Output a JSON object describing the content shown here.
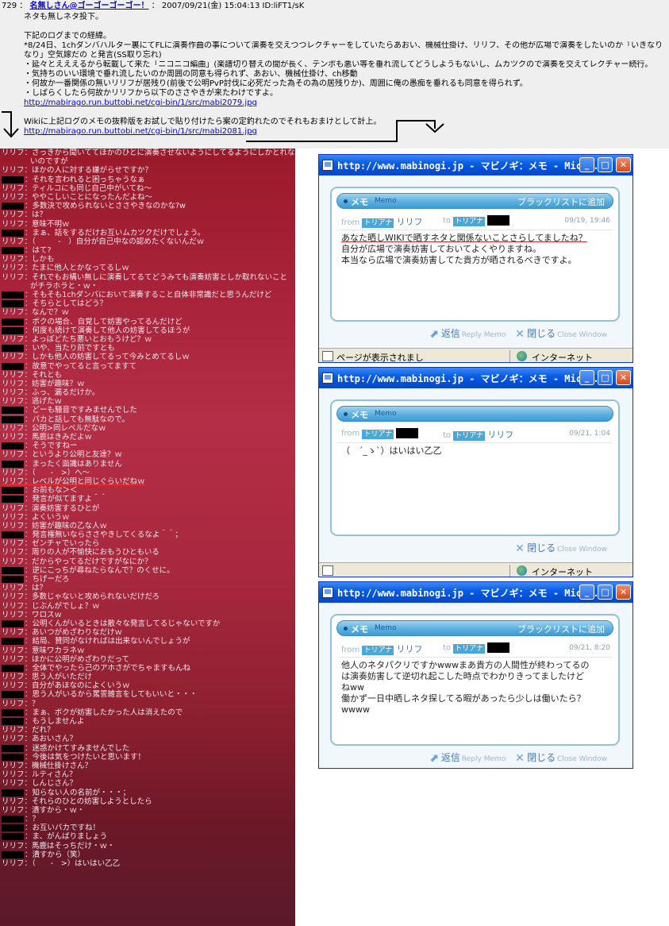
{
  "post": {
    "number": "729",
    "name": "名無しさん@ゴーゴーゴーゴー！",
    "datetime": "2007/09/21(金) 15:04:13 ID:liFT1/sK",
    "lines": [
      "ネタも無しネタ投下。",
      "",
      "下記のログまでの経緯。",
      "*8/24日、1chダンバハルター裏にてFLに演奏作曲の事について演奏を交えつつレクチャーをしていたらあおい、機械仕掛け、リリフ、その他が広場で演奏をしたいのか「いきなり」",
      "なり」空気嫁だの と発言(SS取り忘れ)",
      "・延々とえええるから転載して来た「ニコニコ編曲」(楽譜切り替えの間が長く、テンポも悪い等を垂れ流してどうしようもないし、ムカツクので演奏を交えてレクチャー続行。",
      "・気持ちのいい環境で垂れ流したいのか周囲の同意も得られず、あおい、機械仕掛け、ch移動",
      "・何故か一番関係の無いリリフが居残り(前後で公明PvP討伐に必死だった為その為の居残りか)、周囲に俺の愚痴を垂れるも同意を得られず。",
      "・しばらくしたら何故かリリフから以下のささやきが来たわけですよ。"
    ],
    "link1": "http://mabirago.run.buttobi.net/cgi-bin/1/src/mabi2079.jpg",
    "note": "Wikiに上記ログのメモの抜粋版をお試しで貼り付けたら案の定釣れたのでそれもおまけとして計上。",
    "link2": "http://mabirago.run.buttobi.net/cgi-bin/1/src/mabi2081.jpg"
  },
  "chat": [
    {
      "s": "リリフ",
      "t": "：さっきから聞いててほかのひとに演奏させないようにしてるようにしかとれないのですが"
    },
    {
      "s": "",
      "t": "いのですが",
      "cont": true
    },
    {
      "s": "リリフ",
      "t": "：ほかの人に対する嫌がらせですか？"
    },
    {
      "s": "",
      "t": "：それを言われると困っちゃうなぁ"
    },
    {
      "s": "リリフ",
      "t": "：ティルコにも同じ自己中がいてね～"
    },
    {
      "s": "リリフ",
      "t": "：ややこしいことになったんだよね～"
    },
    {
      "s": "",
      "t": "：多数決で攻められないとささやきなのかな?w"
    },
    {
      "s": "リリフ",
      "t": "：は？"
    },
    {
      "s": "リリフ",
      "t": "：意味不明ｗ"
    },
    {
      "s": "",
      "t": "：まぁ、話をするだけお互いムカツクだけでしょう。"
    },
    {
      "s": "リリフ",
      "t": "：（　　　-　）自分が自己中なの認めたくないんだｗ"
    },
    {
      "s": "",
      "t": "：はて?"
    },
    {
      "s": "リリフ",
      "t": "：しかも"
    },
    {
      "s": "リリフ",
      "t": "：たまに他人とかなってるしｗ"
    },
    {
      "s": "リリフ",
      "t": "：それでもお構い無しに演奏してるてどうみても演奏妨害としか取れないこと"
    },
    {
      "s": "",
      "t": "がチラホラと・ｗ・",
      "cont": true
    },
    {
      "s": "",
      "t": "：そもそも1chダンバにおいて演奏すること自体非常識だと思うんだけど"
    },
    {
      "s": "",
      "t": "：そちらとしてはどう？"
    },
    {
      "s": "リリフ",
      "t": "：なんで？ｗ"
    },
    {
      "s": "",
      "t": "：ボクの場合、自覚して妨害やってるんだけど"
    },
    {
      "s": "",
      "t": "：何度も続けて演奏して他人の妨害してるほうが"
    },
    {
      "s": "リリフ",
      "t": "：よっぽどたち悪いとおもうけど？ｗ"
    },
    {
      "s": "",
      "t": "：いや、当たり前ですとも"
    },
    {
      "s": "リリフ",
      "t": "：しかも他人の妨害してるって今みとめてるしｗ"
    },
    {
      "s": "",
      "t": "：故意でやってると言ってますて"
    },
    {
      "s": "リリフ",
      "t": "：それとも"
    },
    {
      "s": "リリフ",
      "t": "：妨害が趣味？ｗ"
    },
    {
      "s": "リリフ",
      "t": "：ふっ、漏るだけか。"
    },
    {
      "s": "リリフ",
      "t": "：逃げたｗ"
    },
    {
      "s": "",
      "t": "：どーも騒音ですみませんでした"
    },
    {
      "s": "",
      "t": "：バカと話しても無駄なので。"
    },
    {
      "s": "リリフ",
      "t": "：公明>同レベルだなｗ"
    },
    {
      "s": "リリフ",
      "t": "：馬鹿はきみだよｗ"
    },
    {
      "s": "",
      "t": "：そうですねー"
    },
    {
      "s": "リリフ",
      "t": "：というより公明と友達？ｗ"
    },
    {
      "s": "",
      "t": "：まったく面識はありません"
    },
    {
      "s": "リリフ",
      "t": "：（　　-　>）へ～"
    },
    {
      "s": "リリフ",
      "t": "：レベルが公明と同じぐらいだねｗ",
      "ul": true
    },
    {
      "s": "",
      "t": "：お前もな＞＜"
    },
    {
      "s": "",
      "t": "：発言が似てますよ＾＾"
    },
    {
      "s": "リリフ",
      "t": "：演奏妨害するひとが"
    },
    {
      "s": "リリフ",
      "t": "：よくいうｗ"
    },
    {
      "s": "リリフ",
      "t": "：妨害が趣味の乙な人ｗ"
    },
    {
      "s": "",
      "t": "：発言権無いならささやきしてくるなよ＾＾；"
    },
    {
      "s": "リリフ",
      "t": "：ゼンチャでいったら"
    },
    {
      "s": "リリフ",
      "t": "：周りの人が不愉快におもうひともいる"
    },
    {
      "s": "リリフ",
      "t": "：だからやってるだけですがなにか？"
    },
    {
      "s": "",
      "t": "：逆にこっちが尋ねたらなんで？のくせに。"
    },
    {
      "s": "",
      "t": "：ちげーだろ"
    },
    {
      "s": "リリフ",
      "t": "：は？"
    },
    {
      "s": "リリフ",
      "t": "：多数じゃないと攻められないだけだろ"
    },
    {
      "s": "リリフ",
      "t": "：じぶんがでしょ？ｗ"
    },
    {
      "s": "リリフ",
      "t": "：ワロスｗ"
    },
    {
      "s": "",
      "t": "：公明くんがいるときは散々な発言してるじゃないですか"
    },
    {
      "s": "リリフ",
      "t": "：あいつがめざわりなだけｗ"
    },
    {
      "s": "",
      "t": "：結局、賛同がなければは出来ないんでしょうが"
    },
    {
      "s": "リリフ",
      "t": "：意味ワカラネｗ"
    },
    {
      "s": "リリフ",
      "t": "：ほかに公明がめざわりだって"
    },
    {
      "s": "",
      "t": "：全体でやったら己のアホさがでちゃますもんね"
    },
    {
      "s": "リリフ",
      "t": "：思う人がいただけ"
    },
    {
      "s": "リリフ",
      "t": "：自分があほなのによくいうｗ"
    },
    {
      "s": "",
      "t": "：思う人がいるから罵詈雑言をしてもいいと・・・"
    },
    {
      "s": "リリフ",
      "t": "：？"
    },
    {
      "s": "",
      "t": "：まぁ、ボクが妨害したかった人は消えたので"
    },
    {
      "s": "",
      "t": "：もうしませんよ"
    },
    {
      "s": "リリフ",
      "t": "：だれ？"
    },
    {
      "s": "リリフ",
      "t": "：あおいさん？"
    },
    {
      "s": "",
      "t": "：迷惑かけてすみませんでした"
    },
    {
      "s": "",
      "t": "：今後は気をつけたいと思います！"
    },
    {
      "s": "リリフ",
      "t": "：機械仕掛けさん？"
    },
    {
      "s": "リリフ",
      "t": "：ルティさん？"
    },
    {
      "s": "リリフ",
      "t": "：しんじさん？"
    },
    {
      "s": "",
      "t": "：知らない人の名前が・・・；"
    },
    {
      "s": "リリフ",
      "t": "：それらのひとの妨害しようとしたら"
    },
    {
      "s": "リリフ",
      "t": "：潰すから・ｗ・"
    },
    {
      "s": "",
      "t": "：？"
    },
    {
      "s": "",
      "t": "：お互いバカですね！"
    },
    {
      "s": "",
      "t": "：ま、がんばりましょう"
    },
    {
      "s": "リリフ",
      "t": "：馬鹿はそっちだけ・ｗ・"
    },
    {
      "s": "",
      "t": "：潰すから（笑）"
    },
    {
      "s": "リリフ",
      "t": "：（　　-　>）はいはい乙乙"
    }
  ],
  "windows": [
    {
      "title": "http://www.mabinogi.jp - マビノギ：メモ - Mic...",
      "memo_label": "メモ",
      "memo_en": "Memo",
      "blacklist": "ブラックリストに追加",
      "from_label": "from",
      "to_label": "to",
      "server": "トリアナ",
      "from_name": "リリフ",
      "to_name": "",
      "date": "09/19, 19:46",
      "message": [
        "あなた晒しWIKIで晒すネタと関係ないことさらしてましたね？",
        "自分が広場で演奏妨害しておいてよくやりますね。",
        "本当なら広場で演奏妨害してた貴方が晒されるべきですよ。"
      ],
      "reply": "返信",
      "reply_en": "Reply Memo",
      "close": "閉じる",
      "close_en": "Close Window",
      "status": "ページが表示されまし",
      "internet": "インターネット"
    },
    {
      "title": "http://www.mabinogi.jp - マビノギ：メモ - Mic...",
      "memo_label": "メモ",
      "memo_en": "Memo",
      "from_label": "from",
      "to_label": "to",
      "server": "トリアナ",
      "from_name": "",
      "to_name": "リリフ",
      "date": "09/21, 1:04",
      "message": [
        "（　´_ゝ`）はいはい乙乙"
      ],
      "close": "閉じる",
      "close_en": "Close Window",
      "internet": "インターネット"
    },
    {
      "title": "http://www.mabinogi.jp - マビノギ：メモ - Mic...",
      "memo_label": "メモ",
      "memo_en": "Memo",
      "blacklist": "ブラックリストに追加",
      "from_label": "from",
      "to_label": "to",
      "server": "トリアナ",
      "from_name": "リリフ",
      "to_name": "",
      "date": "09/21, 8:20",
      "message": [
        "他人のネタパクリですかwwwまあ貴方の人間性が終わってるの",
        "は演奏妨害して逆切れ起こした時点でわかりきってましたけど",
        "ねww",
        "働かず一日中晒しネタ探してる暇があったら少しは働いたら？",
        "wwww"
      ],
      "reply": "返信",
      "reply_en": "Reply Memo",
      "close": "閉じる",
      "close_en": "Close Window"
    }
  ]
}
